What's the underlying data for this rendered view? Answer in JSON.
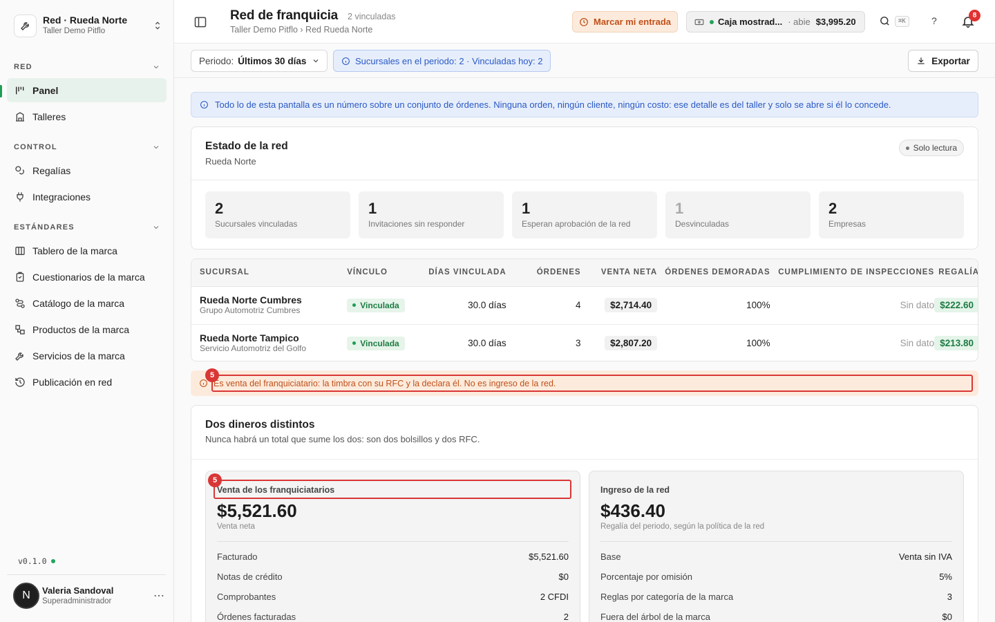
{
  "org": {
    "name": "Red · Rueda Norte",
    "subtitle": "Taller Demo Pitflo"
  },
  "sidebar": {
    "sections": [
      {
        "title": "RED",
        "items": [
          {
            "label": "Panel",
            "icon": "dashboard-icon",
            "active": true
          },
          {
            "label": "Talleres",
            "icon": "building-icon"
          }
        ]
      },
      {
        "title": "CONTROL",
        "items": [
          {
            "label": "Regalías",
            "icon": "coins-icon"
          },
          {
            "label": "Integraciones",
            "icon": "plug-icon"
          }
        ]
      },
      {
        "title": "ESTÁNDARES",
        "items": [
          {
            "label": "Tablero de la marca",
            "icon": "columns-icon"
          },
          {
            "label": "Cuestionarios de la marca",
            "icon": "clipboard-icon"
          },
          {
            "label": "Catálogo de la marca",
            "icon": "catalog-icon"
          },
          {
            "label": "Productos de la marca",
            "icon": "boxes-icon"
          },
          {
            "label": "Servicios de la marca",
            "icon": "wrench-icon"
          },
          {
            "label": "Publicación en red",
            "icon": "history-icon"
          }
        ]
      }
    ],
    "version": "v0.1.0",
    "user": {
      "initial": "N",
      "name": "Valeria Sandoval",
      "role": "Superadministrador"
    }
  },
  "header": {
    "title": "Red de franquicia",
    "count": "2 vinculadas",
    "breadcrumb": "Taller Demo Pitflo › Red Rueda Norte",
    "entry_button": "Marcar mi entrada",
    "cash": {
      "label": "Caja mostrad...",
      "status": "abie",
      "amount": "$3,995.20"
    },
    "kbd": "⌘K",
    "help": "?",
    "notifications": "8"
  },
  "toolbar": {
    "period_label": "Periodo:",
    "period_value": "Últimos 30 días",
    "info": "Sucursales en el periodo: 2 · Vinculadas hoy: 2",
    "export": "Exportar"
  },
  "info_banner": "Todo lo de esta pantalla es un número sobre un conjunto de órdenes. Ninguna orden, ningún cliente, ningún costo: ese detalle es del taller y solo se abre si él lo concede.",
  "state_card": {
    "title": "Estado de la red",
    "subtitle": "Rueda Norte",
    "badge": "Solo lectura",
    "stats": [
      {
        "value": "2",
        "label": "Sucursales vinculadas"
      },
      {
        "value": "1",
        "label": "Invitaciones sin responder"
      },
      {
        "value": "1",
        "label": "Esperan aprobación de la red"
      },
      {
        "value": "1",
        "label": "Desvinculadas"
      },
      {
        "value": "2",
        "label": "Empresas"
      }
    ]
  },
  "table": {
    "headers": [
      "SUCURSAL",
      "VÍNCULO",
      "DÍAS VINCULADA",
      "ÓRDENES",
      "VENTA NETA",
      "ÓRDENES DEMORADAS",
      "CUMPLIMIENTO DE INSPECCIONES",
      "REGALÍA"
    ],
    "rows": [
      {
        "name": "Rueda Norte Cumbres",
        "company": "Grupo Automotriz Cumbres",
        "link": "Vinculada",
        "days": "30.0 días",
        "orders": "4",
        "net_sale": "$2,714.40",
        "delayed": "100%",
        "inspections": "Sin dato",
        "royalty": "$222.60"
      },
      {
        "name": "Rueda Norte Tampico",
        "company": "Servicio Automotriz del Golfo",
        "link": "Vinculada",
        "days": "30.0 días",
        "orders": "3",
        "net_sale": "$2,807.20",
        "delayed": "100%",
        "inspections": "Sin dato",
        "royalty": "$213.80"
      }
    ]
  },
  "warning_banner": "Es venta del franquiciatario: la timbra con su RFC y la declara él. No es ingreso de la red.",
  "annotations": {
    "marker": "5"
  },
  "money_card": {
    "title": "Dos dineros distintos",
    "subtitle": "Nunca habrá un total que sume los dos: son dos bolsillos y dos RFC.",
    "left": {
      "label": "Venta de los franquiciatarios",
      "amount": "$5,521.60",
      "note": "Venta neta",
      "rows": [
        {
          "k": "Facturado",
          "v": "$5,521.60"
        },
        {
          "k": "Notas de crédito",
          "v": "$0"
        },
        {
          "k": "Comprobantes",
          "v": "2 CFDI"
        },
        {
          "k": "Órdenes facturadas",
          "v": "2"
        }
      ]
    },
    "right": {
      "label": "Ingreso de la red",
      "amount": "$436.40",
      "note": "Regalía del periodo, según la política de la red",
      "rows": [
        {
          "k": "Base",
          "v": "Venta sin IVA"
        },
        {
          "k": "Porcentaje por omisión",
          "v": "5%"
        },
        {
          "k": "Reglas por categoría de la marca",
          "v": "3"
        },
        {
          "k": "Fuera del árbol de la marca",
          "v": "$0"
        }
      ]
    }
  }
}
